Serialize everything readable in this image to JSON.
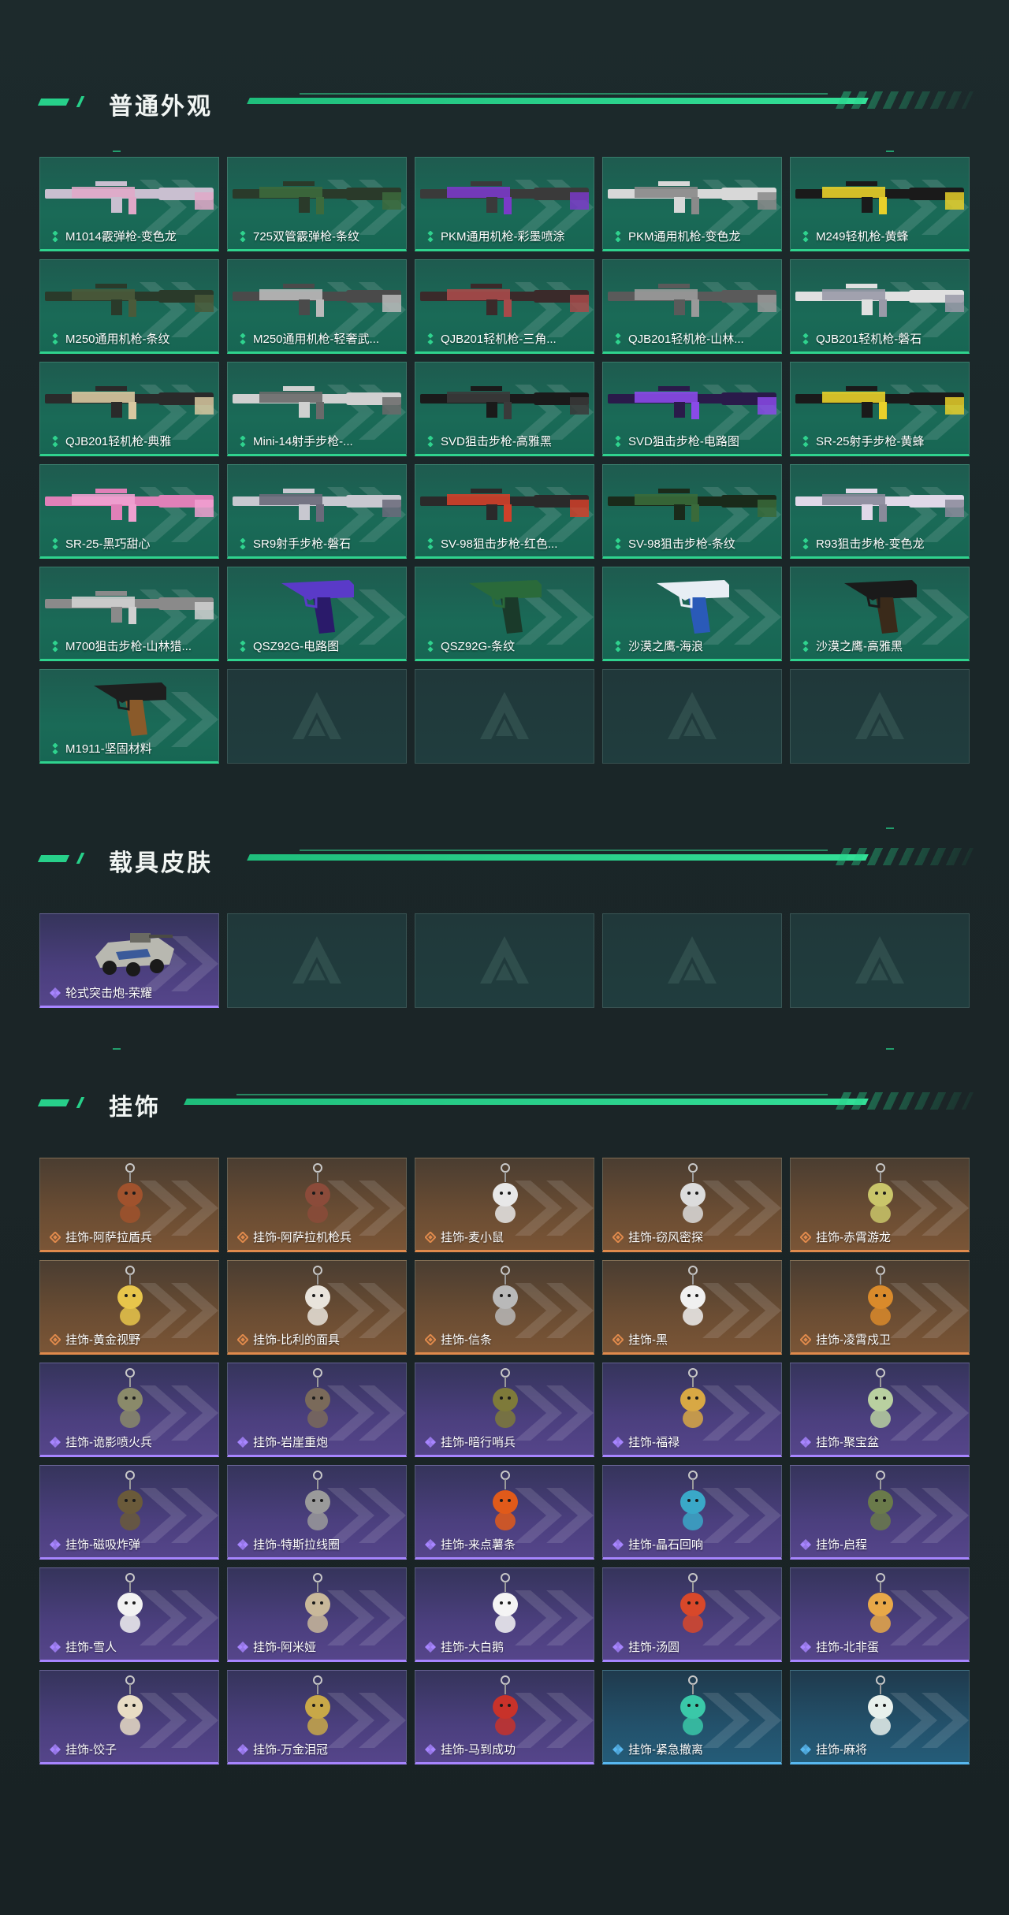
{
  "sections": {
    "skins": {
      "title": "普通外观",
      "items": [
        {
          "label": "M1014霰弹枪-变色龙",
          "rarity": "green",
          "art": "shotgun-pink"
        },
        {
          "label": "725双管霰弹枪-条纹",
          "rarity": "green",
          "art": "shotgun-green"
        },
        {
          "label": "PKM通用机枪-彩墨喷涂",
          "rarity": "green",
          "art": "mg-purple"
        },
        {
          "label": "PKM通用机枪-变色龙",
          "rarity": "green",
          "art": "mg-white"
        },
        {
          "label": "M249轻机枪-黄蜂",
          "rarity": "green",
          "art": "mg-yellow"
        },
        {
          "label": "M250通用机枪-条纹",
          "rarity": "green",
          "art": "mg-camo"
        },
        {
          "label": "M250通用机枪-轻奢武...",
          "rarity": "green",
          "art": "mg-grey"
        },
        {
          "label": "QJB201轻机枪-三角...",
          "rarity": "green",
          "art": "lmg-red"
        },
        {
          "label": "QJB201轻机枪-山林...",
          "rarity": "green",
          "art": "lmg-grey"
        },
        {
          "label": "QJB201轻机枪-磐石",
          "rarity": "green",
          "art": "lmg-white"
        },
        {
          "label": "QJB201轻机枪-典雅",
          "rarity": "green",
          "art": "lmg-tan"
        },
        {
          "label": "Mini-14射手步枪-...",
          "rarity": "green",
          "art": "rifle-white"
        },
        {
          "label": "SVD狙击步枪-高雅黑",
          "rarity": "green",
          "art": "sniper-black"
        },
        {
          "label": "SVD狙击步枪-电路图",
          "rarity": "green",
          "art": "sniper-purple"
        },
        {
          "label": "SR-25射手步枪-黄蜂",
          "rarity": "green",
          "art": "rifle-yellow"
        },
        {
          "label": "SR-25-黑巧甜心",
          "rarity": "green",
          "art": "rifle-pink"
        },
        {
          "label": "SR9射手步枪-磐石",
          "rarity": "green",
          "art": "rifle-grey"
        },
        {
          "label": "SV-98狙击步枪-红色...",
          "rarity": "green",
          "art": "sniper-red"
        },
        {
          "label": "SV-98狙击步枪-条纹",
          "rarity": "green",
          "art": "sniper-green"
        },
        {
          "label": "R93狙击步枪-变色龙",
          "rarity": "green",
          "art": "sniper-white"
        },
        {
          "label": "M700狙击步枪-山林猎...",
          "rarity": "green",
          "art": "bolt-grey"
        },
        {
          "label": "QSZ92G-电路图",
          "rarity": "green",
          "art": "pistol-purple"
        },
        {
          "label": "QSZ92G-条纹",
          "rarity": "green",
          "art": "pistol-green"
        },
        {
          "label": "沙漠之鹰-海浪",
          "rarity": "green",
          "art": "deagle-blue"
        },
        {
          "label": "沙漠之鹰-高雅黑",
          "rarity": "green",
          "art": "deagle-black"
        },
        {
          "label": "M1911-坚固材料",
          "rarity": "green",
          "art": "m1911"
        }
      ],
      "empty_slots": 4
    },
    "vehicles": {
      "title": "载具皮肤",
      "items": [
        {
          "label": "轮式突击炮-荣耀",
          "rarity": "purple",
          "art": "vehicle"
        }
      ],
      "empty_slots": 4
    },
    "charms": {
      "title": "挂饰",
      "items": [
        {
          "label": "挂饰-阿萨拉盾兵",
          "rarity": "orange",
          "color": "#a0522d"
        },
        {
          "label": "挂饰-阿萨拉机枪兵",
          "rarity": "orange",
          "color": "#8b4b3a"
        },
        {
          "label": "挂饰-麦小鼠",
          "rarity": "orange",
          "color": "#e8e8e8"
        },
        {
          "label": "挂饰-窃风密探",
          "rarity": "orange",
          "color": "#dcdcdc"
        },
        {
          "label": "挂饰-赤霄游龙",
          "rarity": "orange",
          "color": "#c9c56a"
        },
        {
          "label": "挂饰-黄金视野",
          "rarity": "orange",
          "color": "#e7c54b"
        },
        {
          "label": "挂饰-比利的面具",
          "rarity": "orange",
          "color": "#e9e4dc"
        },
        {
          "label": "挂饰-信条",
          "rarity": "orange",
          "color": "#b9b9b9"
        },
        {
          "label": "挂饰-黑",
          "rarity": "orange",
          "color": "#f0f0f0"
        },
        {
          "label": "挂饰-凌霄戍卫",
          "rarity": "orange",
          "color": "#d98a2b"
        },
        {
          "label": "挂饰-诡影喷火兵",
          "rarity": "purple",
          "color": "#8a8a6a"
        },
        {
          "label": "挂饰-岩崖重炮",
          "rarity": "purple",
          "color": "#7a6a5a"
        },
        {
          "label": "挂饰-暗行哨兵",
          "rarity": "purple",
          "color": "#7e7a3a"
        },
        {
          "label": "挂饰-福禄",
          "rarity": "purple",
          "color": "#d8a844"
        },
        {
          "label": "挂饰-聚宝盆",
          "rarity": "purple",
          "color": "#b9d0a0"
        },
        {
          "label": "挂饰-磁吸炸弹",
          "rarity": "purple",
          "color": "#6a5a3a"
        },
        {
          "label": "挂饰-特斯拉线圈",
          "rarity": "purple",
          "color": "#9a9a9a"
        },
        {
          "label": "挂饰-来点薯条",
          "rarity": "purple",
          "color": "#e05a1a"
        },
        {
          "label": "挂饰-晶石回响",
          "rarity": "purple",
          "color": "#3aa8c8"
        },
        {
          "label": "挂饰-启程",
          "rarity": "purple",
          "color": "#6a7a4a"
        },
        {
          "label": "挂饰-雪人",
          "rarity": "purple",
          "color": "#f2f2f2"
        },
        {
          "label": "挂饰-阿米娅",
          "rarity": "purple",
          "color": "#c9b89a"
        },
        {
          "label": "挂饰-大白鹅",
          "rarity": "purple",
          "color": "#f4f4f4"
        },
        {
          "label": "挂饰-汤圆",
          "rarity": "purple",
          "color": "#d8482a"
        },
        {
          "label": "挂饰-北非蛋",
          "rarity": "purple",
          "color": "#e8a848"
        },
        {
          "label": "挂饰-饺子",
          "rarity": "purple",
          "color": "#e8dcc4"
        },
        {
          "label": "挂饰-万金泪冠",
          "rarity": "purple",
          "color": "#c8a848"
        },
        {
          "label": "挂饰-马到成功",
          "rarity": "purple",
          "color": "#c8322a"
        },
        {
          "label": "挂饰-紧急撤离",
          "rarity": "blue",
          "color": "#3ac8a8"
        },
        {
          "label": "挂饰-麻将",
          "rarity": "blue",
          "color": "#e8f0ec"
        }
      ],
      "empty_slots": 0
    }
  },
  "icons": {
    "rarity_green": "diamond-dots-icon",
    "rarity_orange": "orange-diamond-icon",
    "rarity_purple": "purple-diamond-icon",
    "rarity_blue": "blue-diamond-icon",
    "empty": "game-logo-icon"
  },
  "colors": {
    "accent": "#27d08a",
    "green_card": "#1a6a57",
    "orange_card": "#6b4d33",
    "purple_card": "#4b3f7e",
    "blue_card": "#23516b"
  }
}
